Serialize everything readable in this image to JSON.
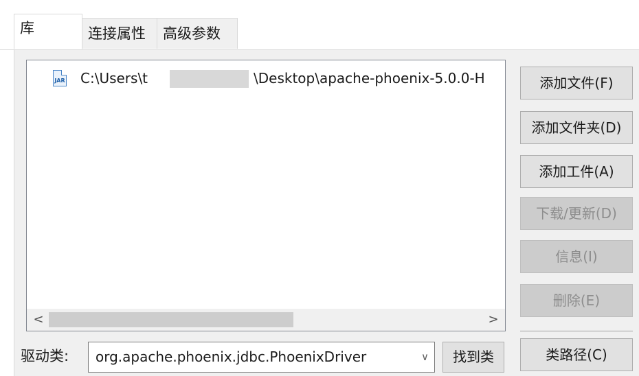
{
  "tabs": [
    {
      "label": "库",
      "active": true
    },
    {
      "label": "连接属性",
      "active": false
    },
    {
      "label": "高级参数",
      "active": false
    }
  ],
  "library": {
    "items": [
      {
        "icon": "jar-file-icon",
        "icon_text": "JAR",
        "path_start": "C:\\Users\\t",
        "path_end": "\\Desktop\\apache-phoenix-5.0.0-H"
      }
    ],
    "scroll_left": "<",
    "scroll_right": ">"
  },
  "buttons": {
    "add_file": "添加文件(F)",
    "add_folder": "添加文件夹(D)",
    "add_artifact": "添加工件(A)",
    "download_update": "下载/更新(D)",
    "info": "信息(I)",
    "delete": "删除(E)",
    "classpath": "类路径(C)"
  },
  "driver": {
    "label": "驱动类:",
    "value": "org.apache.phoenix.jdbc.PhoenixDriver",
    "find_class": "找到类"
  },
  "colors": {
    "panel_bg": "#f0f0f0",
    "button_bg": "#e1e1e1",
    "disabled_text": "#8d8d8d",
    "icon_blue": "#4a86c8"
  }
}
